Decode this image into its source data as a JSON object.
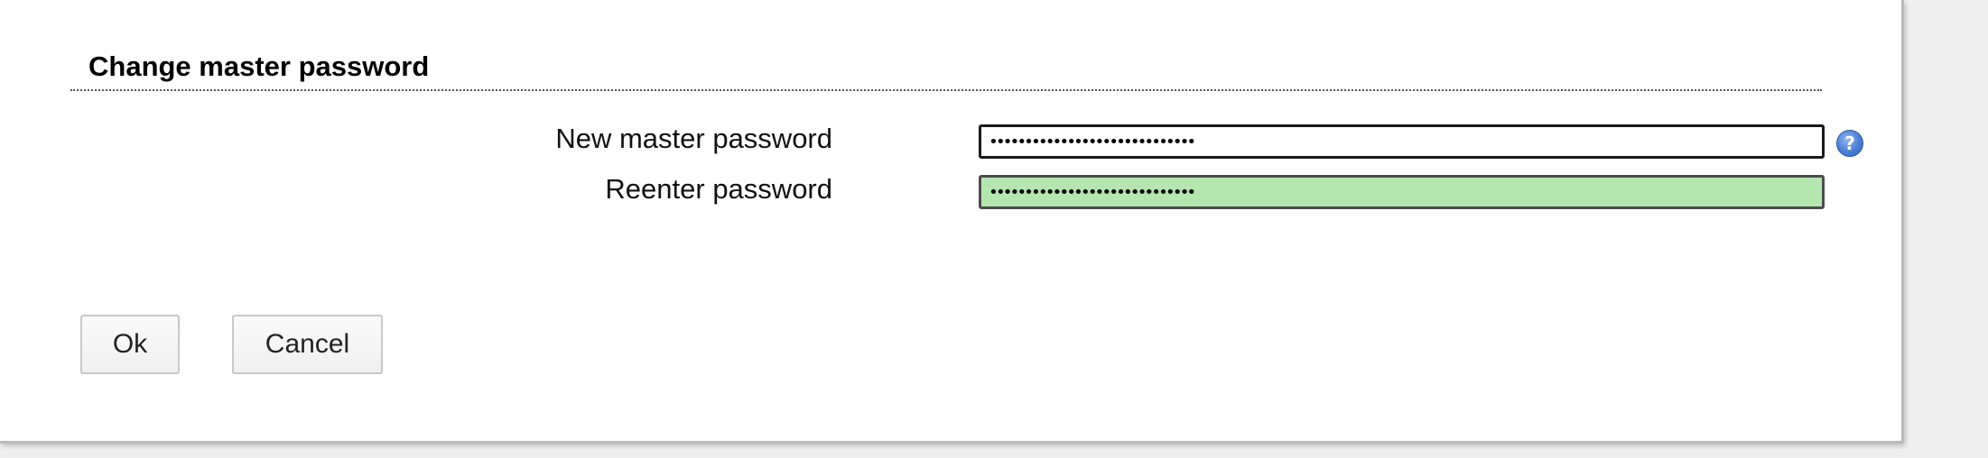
{
  "dialog": {
    "section_title": "Change master password"
  },
  "form": {
    "new_password_label": "New master password",
    "new_password_value": "•••••••••••••••••••••••••••••",
    "reenter_password_label": "Reenter password",
    "reenter_password_value": "•••••••••••••••••••••••••••••",
    "help_icon_glyph": "?"
  },
  "buttons": {
    "ok_label": "Ok",
    "cancel_label": "Cancel"
  },
  "colors": {
    "match_field_background": "#b6e6b0",
    "help_icon": "#4a7fd6"
  }
}
